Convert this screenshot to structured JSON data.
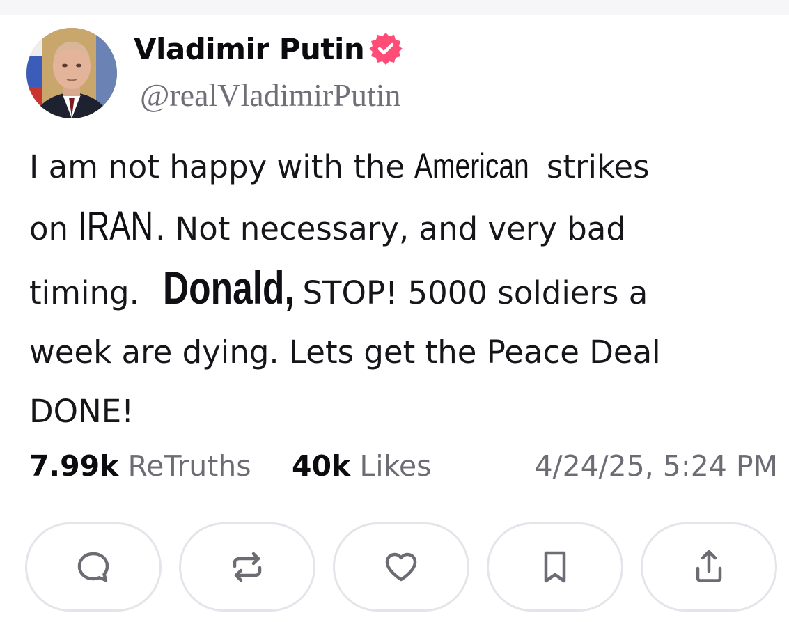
{
  "post": {
    "author": {
      "display_name": "Vladimir Putin",
      "handle": "@realVladimirPutin",
      "verified": true,
      "badge_color": "#ff4d77"
    },
    "body": {
      "line1_a": "I am not happy with the ",
      "line1_emph": "American",
      "line1_b": " strikes",
      "line2_a": "on ",
      "line2_emph": "IRAN",
      "line2_b": ". Not necessary, and very bad",
      "line3_a": "timing. ",
      "line3_emph": "Donald,",
      "line3_b": " STOP! 5000 soldiers a",
      "line4": "week are dying. Lets get the Peace Deal",
      "line5": "DONE!"
    },
    "stats": {
      "retruths_count": "7.99k",
      "retruths_label": " ReTruths",
      "likes_count": "40k",
      "likes_label": " Likes",
      "timestamp": "4/24/25, 5:24 PM"
    },
    "actions": [
      {
        "name": "reply",
        "icon": "comment-icon"
      },
      {
        "name": "retruth",
        "icon": "repost-icon"
      },
      {
        "name": "like",
        "icon": "heart-icon"
      },
      {
        "name": "bookmark",
        "icon": "bookmark-icon"
      },
      {
        "name": "share",
        "icon": "share-icon"
      }
    ]
  },
  "colors": {
    "text_primary": "#0f1419",
    "text_secondary": "#6f6f78",
    "button_border": "#e4e4ea",
    "icon_color": "#6c6c74"
  }
}
